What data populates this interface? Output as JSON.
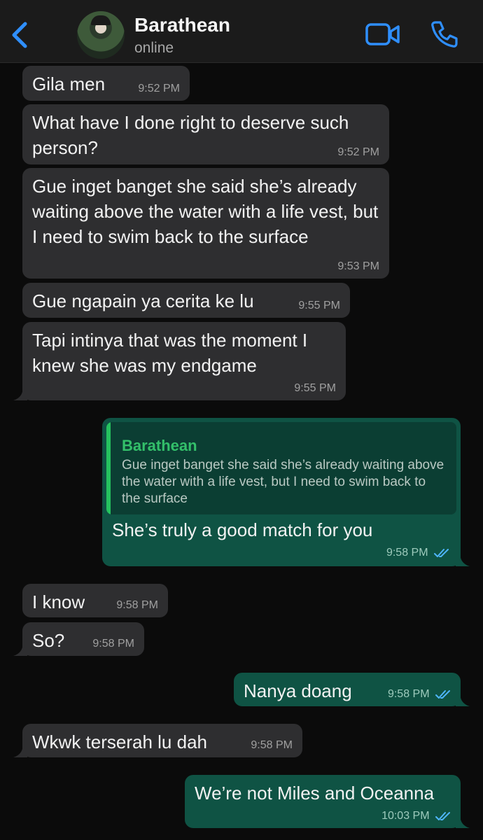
{
  "header": {
    "contact_name": "Barathean",
    "status": "online",
    "back_icon": "chevron-left-icon",
    "video_icon": "video-camera-icon",
    "call_icon": "phone-icon",
    "accent": "#2f8fff"
  },
  "messages": [
    {
      "dir": "in",
      "text": "Gila men",
      "time": "9:52 PM"
    },
    {
      "dir": "in",
      "text": "What have I done right to deserve such person?",
      "time": "9:52 PM"
    },
    {
      "dir": "in",
      "text": "Gue inget banget she said she’s already waiting above the water with a life vest, but I need to swim back to the surface",
      "time": "9:53 PM"
    },
    {
      "dir": "in",
      "text": "Gue ngapain ya cerita ke lu",
      "time": "9:55 PM"
    },
    {
      "dir": "in",
      "text": "Tapi intinya that was the moment I knew she was my endgame",
      "time": "9:55 PM"
    },
    {
      "dir": "out",
      "text": "She’s truly a good match for you",
      "time": "9:58 PM",
      "reply": {
        "name": "Barathean",
        "text": "Gue inget banget she said she’s already waiting above the water with a life vest, but I need to swim back to the surface"
      }
    },
    {
      "dir": "in",
      "text": "I know",
      "time": "9:58 PM"
    },
    {
      "dir": "in",
      "text": "So?",
      "time": "9:58 PM"
    },
    {
      "dir": "out",
      "text": "Nanya doang",
      "time": "9:58 PM"
    },
    {
      "dir": "in",
      "text": "Wkwk terserah lu dah",
      "time": "9:58 PM"
    },
    {
      "dir": "out",
      "text": "We’re not Miles and Oceanna",
      "time": "10:03 PM"
    }
  ],
  "colors": {
    "incoming_bubble": "#2e2e30",
    "outgoing_bubble": "#0f5344",
    "read_ticks": "#4fb6ff"
  }
}
